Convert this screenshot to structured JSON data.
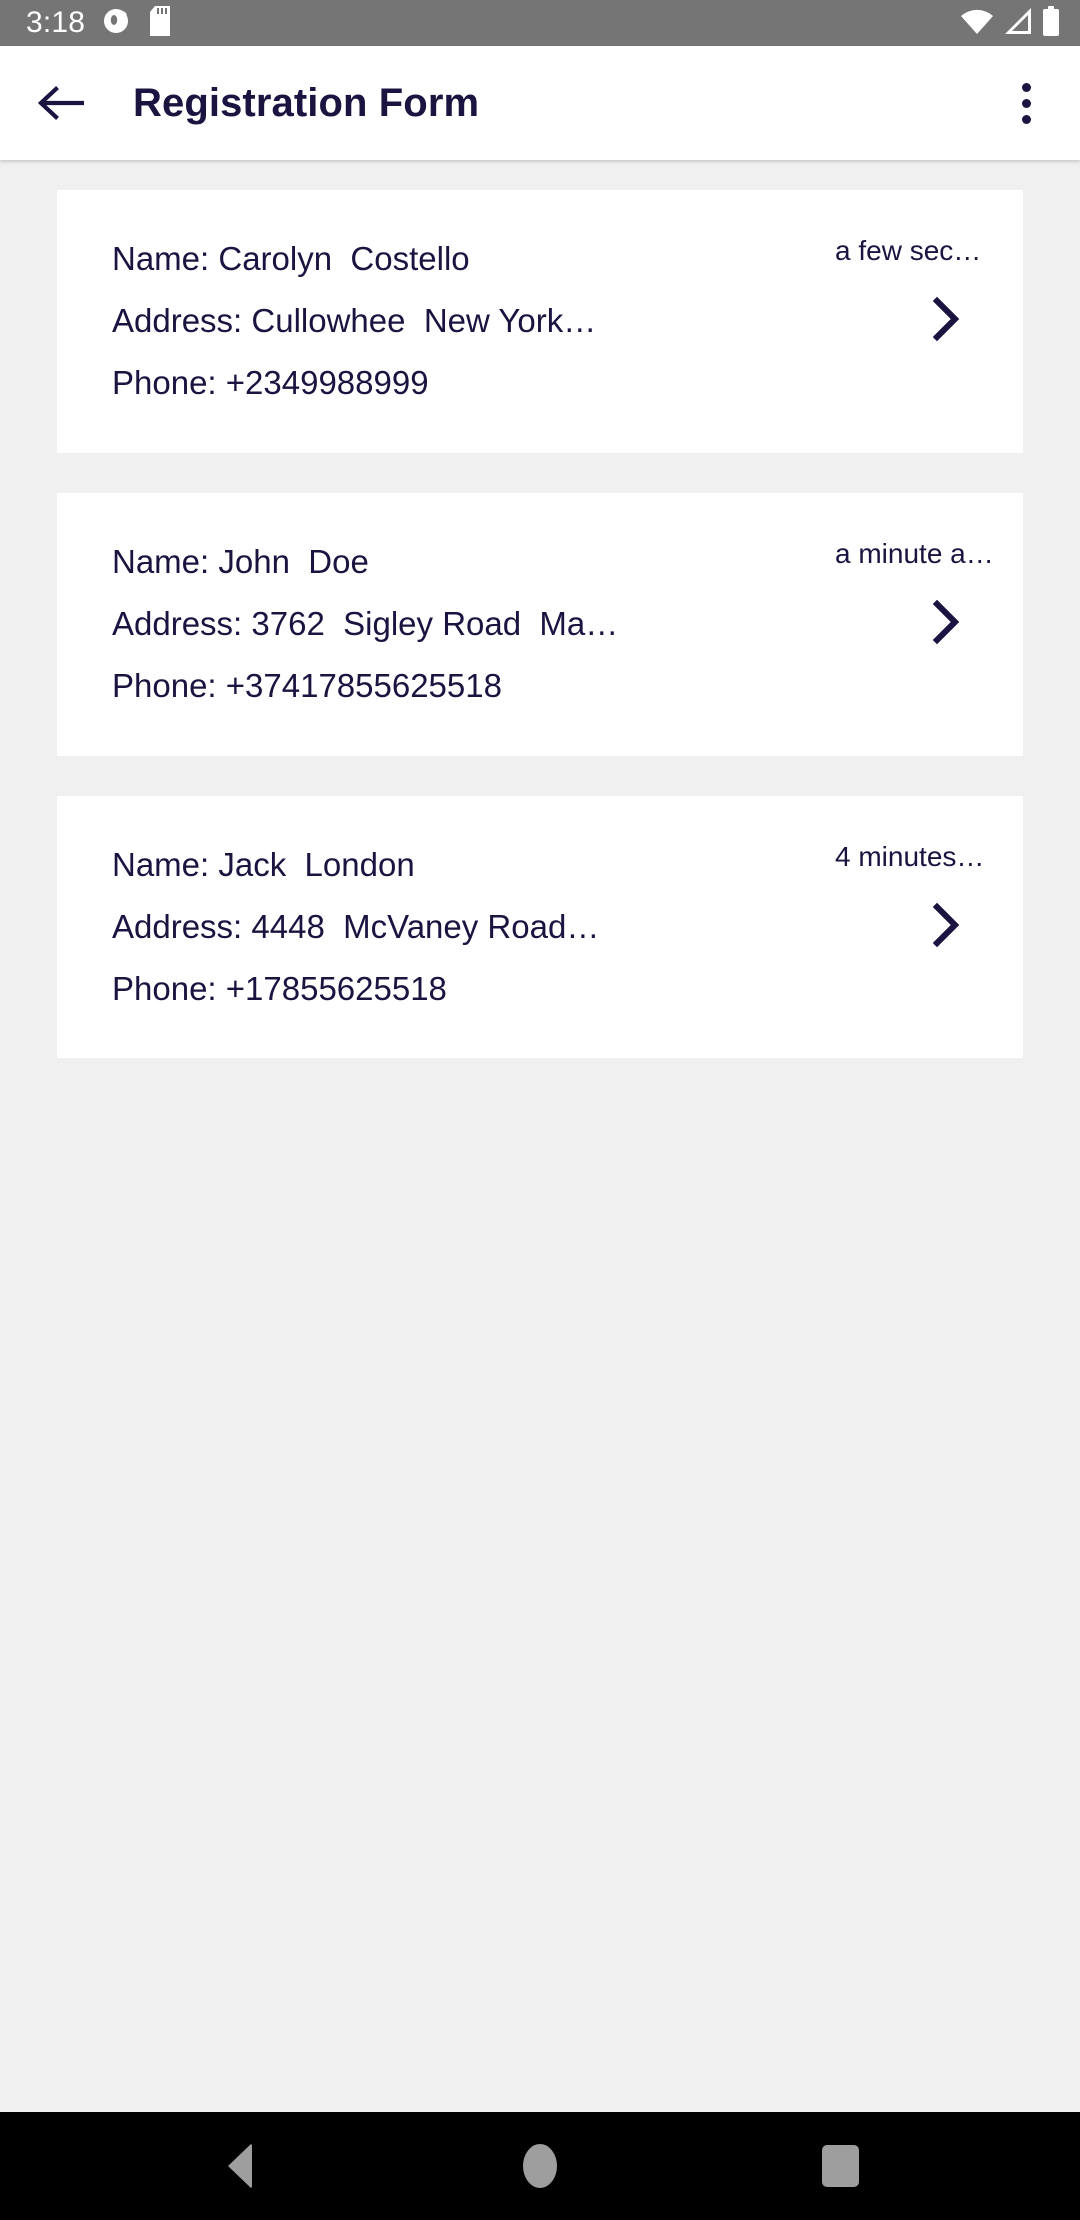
{
  "status_bar": {
    "time": "3:18",
    "left_icons": [
      "notification-icon",
      "sd-card-icon"
    ],
    "right_icons": [
      "wifi-icon",
      "cellular-signal-icon",
      "battery-icon"
    ],
    "background_color": "#757575",
    "foreground_color": "#ffffff"
  },
  "app_bar": {
    "back_label": "back-arrow",
    "title": "Registration Form",
    "overflow_label": "more-options",
    "title_color": "#1b1340",
    "background_color": "#ffffff"
  },
  "list": {
    "background_color": "#f0f0f0",
    "card_color": "#ffffff",
    "items": [
      {
        "name_line": "Name: Carolyn  Costello",
        "address_line": "Address: Cullowhee  New York…",
        "phone_line": "Phone: +2349988999",
        "time_ago": "a few sec…",
        "chevron": "chevron-right-icon"
      },
      {
        "name_line": "Name: John  Doe",
        "address_line": "Address: 3762  Sigley Road  Ma…",
        "phone_line": "Phone: +37417855625518",
        "time_ago": "a minute a…",
        "chevron": "chevron-right-icon"
      },
      {
        "name_line": "Name: Jack  London",
        "address_line": "Address: 4448  McVaney Road…",
        "phone_line": "Phone: +17855625518",
        "time_ago": "4 minutes…",
        "chevron": "chevron-right-icon"
      }
    ]
  },
  "nav_bar": {
    "background_color": "#000000",
    "icon_color": "#9e9e9e",
    "buttons": [
      "back-triangle-icon",
      "home-circle-icon",
      "recents-square-icon"
    ]
  }
}
